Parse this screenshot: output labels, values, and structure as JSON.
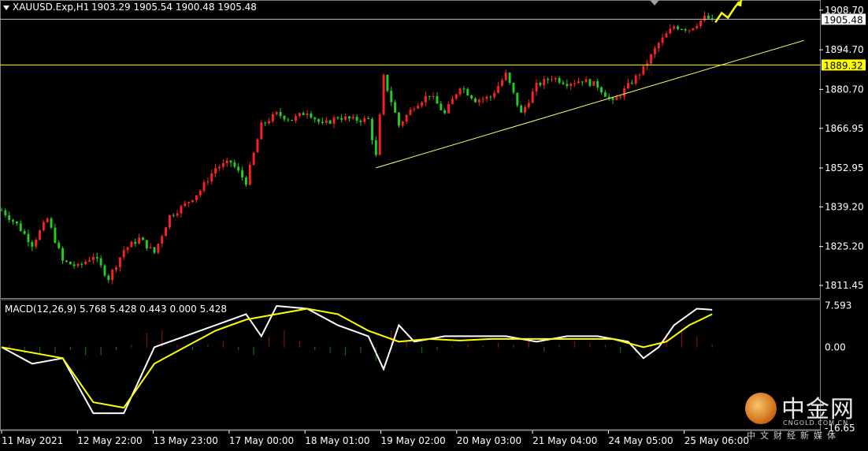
{
  "header": {
    "symbol": "XAUUSD.Exp,H1",
    "ohlc": "1903.29 1905.54 1900.48 1905.48",
    "macd_label": "MACD(12,26,9) 5.768 5.428 0.443 0.000 5.428"
  },
  "colors": {
    "background": "#000000",
    "bull": "#ff2020",
    "bear": "#20d020",
    "trendline": "#ffff66",
    "hline": "#ffff00",
    "pane_border": "#808080",
    "macd_line": "#ffffff",
    "signal_line": "#ffff00",
    "arrow": "#ffff00",
    "price_label_current_bg": "#ffffff",
    "price_label_level_bg": "#ffff00"
  },
  "price_labels": {
    "current": "1905.48",
    "level": "1889.32"
  },
  "watermark": {
    "cn": "中金网",
    "en": "CNGOLD.COM.CN",
    "sub": "中文财经新媒体"
  },
  "chart_data": [
    {
      "type": "candlestick",
      "title": "XAUUSD.Exp,H1",
      "ylim": [
        1807,
        1912
      ],
      "y_ticks": [
        "1908.70",
        "1894.70",
        "1880.70",
        "1866.95",
        "1852.95",
        "1839.20",
        "1825.20",
        "1811.45"
      ],
      "x_ticks": [
        "11 May 2021",
        "12 May 22:00",
        "13 May 23:00",
        "17 May 00:00",
        "18 May 01:00",
        "19 May 02:00",
        "20 May 03:00",
        "21 May 04:00",
        "24 May 05:00",
        "25 May 06:00"
      ],
      "close_path": [
        [
          0,
          1838
        ],
        [
          4,
          1833
        ],
        [
          8,
          1826
        ],
        [
          12,
          1835
        ],
        [
          16,
          1820
        ],
        [
          20,
          1818
        ],
        [
          24,
          1822
        ],
        [
          28,
          1814
        ],
        [
          32,
          1824
        ],
        [
          36,
          1828
        ],
        [
          40,
          1823
        ],
        [
          44,
          1836
        ],
        [
          48,
          1840
        ],
        [
          52,
          1845
        ],
        [
          56,
          1853
        ],
        [
          60,
          1855
        ],
        [
          64,
          1848
        ],
        [
          68,
          1868
        ],
        [
          72,
          1872
        ],
        [
          76,
          1870
        ],
        [
          80,
          1873
        ],
        [
          84,
          1868
        ],
        [
          88,
          1871
        ],
        [
          92,
          1870
        ],
        [
          96,
          1870
        ],
        [
          98,
          1857
        ],
        [
          100,
          1885
        ],
        [
          104,
          1868
        ],
        [
          108,
          1875
        ],
        [
          112,
          1879
        ],
        [
          116,
          1872
        ],
        [
          120,
          1882
        ],
        [
          124,
          1877
        ],
        [
          128,
          1878
        ],
        [
          132,
          1886
        ],
        [
          136,
          1872
        ],
        [
          140,
          1882
        ],
        [
          144,
          1885
        ],
        [
          148,
          1883
        ],
        [
          152,
          1884
        ],
        [
          156,
          1882
        ],
        [
          160,
          1876
        ],
        [
          164,
          1882
        ],
        [
          168,
          1888
        ],
        [
          172,
          1897
        ],
        [
          176,
          1903
        ],
        [
          180,
          1902
        ],
        [
          184,
          1906
        ],
        [
          186,
          1905.48
        ]
      ],
      "hline_price": 1889.32,
      "current_price": 1905.48,
      "trendline": [
        [
          98,
          1853
        ],
        [
          210,
          1898
        ]
      ],
      "arrow_up": true
    },
    {
      "type": "line",
      "title": "MACD(12,26,9)",
      "ylim": [
        -15,
        8.5
      ],
      "y_ticks": [
        "7.593",
        "0.00",
        "-16.65"
      ],
      "series": [
        {
          "name": "MACD",
          "values": [
            [
              0,
              0
            ],
            [
              8,
              -3
            ],
            [
              16,
              -2
            ],
            [
              24,
              -12
            ],
            [
              32,
              -12
            ],
            [
              40,
              0
            ],
            [
              48,
              2
            ],
            [
              56,
              4
            ],
            [
              64,
              6
            ],
            [
              68,
              2
            ],
            [
              72,
              7.5
            ],
            [
              80,
              7
            ],
            [
              88,
              4
            ],
            [
              96,
              2
            ],
            [
              100,
              -4
            ],
            [
              104,
              4
            ],
            [
              108,
              1
            ],
            [
              116,
              2
            ],
            [
              124,
              2
            ],
            [
              132,
              2
            ],
            [
              140,
              1
            ],
            [
              148,
              2
            ],
            [
              156,
              2
            ],
            [
              164,
              1
            ],
            [
              168,
              -2
            ],
            [
              172,
              0
            ],
            [
              176,
              4
            ],
            [
              182,
              7
            ],
            [
              186,
              6.8
            ]
          ]
        },
        {
          "name": "Signal",
          "values": [
            [
              0,
              0
            ],
            [
              8,
              -1
            ],
            [
              16,
              -2
            ],
            [
              24,
              -10
            ],
            [
              32,
              -11
            ],
            [
              40,
              -3
            ],
            [
              48,
              0
            ],
            [
              56,
              3
            ],
            [
              64,
              5
            ],
            [
              72,
              6
            ],
            [
              80,
              7
            ],
            [
              88,
              6
            ],
            [
              96,
              3
            ],
            [
              104,
              1
            ],
            [
              112,
              1.5
            ],
            [
              120,
              1.2
            ],
            [
              128,
              1.5
            ],
            [
              136,
              1.5
            ],
            [
              144,
              1.5
            ],
            [
              152,
              1.5
            ],
            [
              160,
              1.5
            ],
            [
              168,
              0
            ],
            [
              174,
              1
            ],
            [
              180,
              4
            ],
            [
              186,
              6
            ]
          ]
        }
      ],
      "histogram": [
        [
          2,
          0.5
        ],
        [
          6,
          -1
        ],
        [
          10,
          -1.5
        ],
        [
          14,
          -1
        ],
        [
          18,
          -0.5
        ],
        [
          22,
          -1.5
        ],
        [
          26,
          -1.5
        ],
        [
          30,
          -0.5
        ],
        [
          34,
          0.5
        ],
        [
          38,
          2.5
        ],
        [
          42,
          3
        ],
        [
          46,
          0.5
        ],
        [
          50,
          -0.5
        ],
        [
          54,
          0.5
        ],
        [
          58,
          1
        ],
        [
          62,
          -0.5
        ],
        [
          66,
          -1.5
        ],
        [
          70,
          2
        ],
        [
          74,
          3
        ],
        [
          78,
          1
        ],
        [
          82,
          -0.5
        ],
        [
          86,
          -1
        ],
        [
          90,
          -1.5
        ],
        [
          94,
          -1
        ],
        [
          98,
          -2.5
        ],
        [
          102,
          3
        ],
        [
          106,
          1
        ],
        [
          110,
          -1
        ],
        [
          114,
          -0.5
        ],
        [
          118,
          0.3
        ],
        [
          122,
          0.5
        ],
        [
          126,
          0.3
        ],
        [
          130,
          0.8
        ],
        [
          134,
          0.5
        ],
        [
          138,
          1
        ],
        [
          142,
          -0.8
        ],
        [
          146,
          0.5
        ],
        [
          150,
          1
        ],
        [
          154,
          0.8
        ],
        [
          158,
          0.5
        ],
        [
          162,
          -1
        ],
        [
          166,
          -1
        ],
        [
          170,
          0.5
        ],
        [
          174,
          2.5
        ],
        [
          178,
          3
        ],
        [
          182,
          2
        ],
        [
          186,
          0.5
        ]
      ]
    }
  ]
}
